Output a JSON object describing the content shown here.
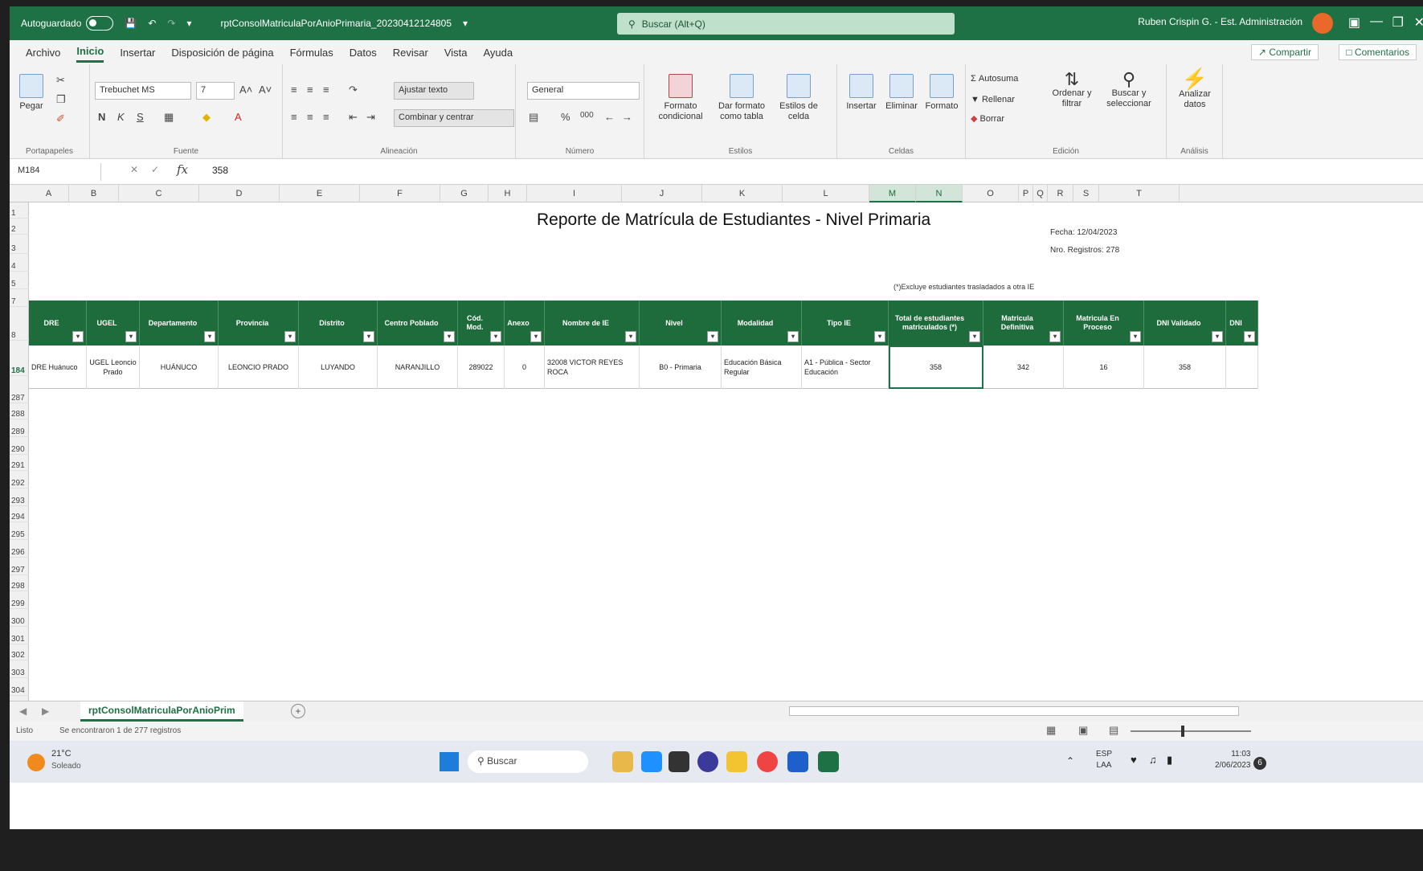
{
  "titlebar": {
    "autosave_label": "Autoguardado",
    "filename": "rptConsolMatriculaPorAnioPrimaria_20230412124805",
    "search_placeholder": "Buscar (Alt+Q)",
    "user": "Ruben Crispin G. - Est. Administración"
  },
  "menu": [
    "Archivo",
    "Inicio",
    "Insertar",
    "Disposición de página",
    "Fórmulas",
    "Datos",
    "Revisar",
    "Vista",
    "Ayuda"
  ],
  "share_label": "Compartir",
  "comments_label": "Comentarios",
  "ribbon": {
    "clipboard": {
      "paste": "Pegar",
      "label": "Portapapeles"
    },
    "font": {
      "name": "Trebuchet MS",
      "size": "7",
      "label": "Fuente"
    },
    "alignment": {
      "wrap": "Ajustar texto",
      "merge": "Combinar y centrar",
      "label": "Alineación"
    },
    "number": {
      "format": "General",
      "label": "Número"
    },
    "styles": {
      "conditional": "Formato condicional",
      "as_table": "Dar formato como tabla",
      "cell_styles": "Estilos de celda",
      "label": "Estilos"
    },
    "cells": {
      "insert": "Insertar",
      "delete": "Eliminar",
      "format": "Formato",
      "label": "Celdas"
    },
    "editing": {
      "autosum": "Autosuma",
      "fill": "Rellenar",
      "clear": "Borrar",
      "sort": "Ordenar y filtrar",
      "find": "Buscar y seleccionar",
      "label": "Edición"
    },
    "analysis": {
      "analyze": "Analizar datos",
      "label": "Análisis"
    }
  },
  "formula": {
    "cell_ref": "M184",
    "value": "358"
  },
  "columns": [
    "A",
    "B",
    "C",
    "D",
    "E",
    "F",
    "G",
    "H",
    "I",
    "J",
    "K",
    "L",
    "M",
    "N",
    "O",
    "P",
    "Q",
    "R",
    "S",
    "T"
  ],
  "rows": [
    "1",
    "2",
    "3",
    "4",
    "5",
    "7",
    "8",
    "184",
    "287",
    "288",
    "289",
    "290",
    "291",
    "292",
    "293",
    "294",
    "295",
    "296",
    "297",
    "298",
    "299",
    "300",
    "301",
    "302",
    "303",
    "304"
  ],
  "report": {
    "title": "Reporte de Matrícula de Estudiantes - Nivel Primaria",
    "fecha": "Fecha: 12/04/2023",
    "registros": "Nro. Registros: 278",
    "note": "(*)Excluye estudiantes trasladados a otra IE"
  },
  "table_headers": [
    "DRE",
    "UGEL",
    "Departamento",
    "Provincia",
    "Distrito",
    "Centro Poblado",
    "Cód. Mod.",
    "Anexo",
    "Nombre de IE",
    "Nivel",
    "Modalidad",
    "Tipo IE",
    "Total de estudiantes matriculados (*)",
    "Matricula Definitiva",
    "Matricula En Proceso",
    "DNI Validado",
    "DNI"
  ],
  "table_row": [
    "DRE Huánuco",
    "UGEL Leoncio Prado",
    "HUÁNUCO",
    "LEONCIO PRADO",
    "LUYANDO",
    "NARANJILLO",
    "289022",
    "0",
    "32008 VICTOR REYES ROCA",
    "B0 - Primaria",
    "Educación Básica Regular",
    "A1 - Pública - Sector Educación",
    "358",
    "342",
    "16",
    "358",
    ""
  ],
  "sheet_tab": "rptConsolMatriculaPorAnioPrim",
  "status": {
    "ready": "Listo",
    "filter": "Se encontraron 1 de 277 registros"
  },
  "taskbar": {
    "temp": "21°C",
    "weather": "Soleado",
    "search": "Buscar",
    "lang": "ESP",
    "lang2": "LAA",
    "time": "11:03",
    "date": "2/06/2023",
    "notif": "6"
  },
  "colors": {
    "excel_green": "#1e7145",
    "header_green": "#1e6b3b"
  }
}
